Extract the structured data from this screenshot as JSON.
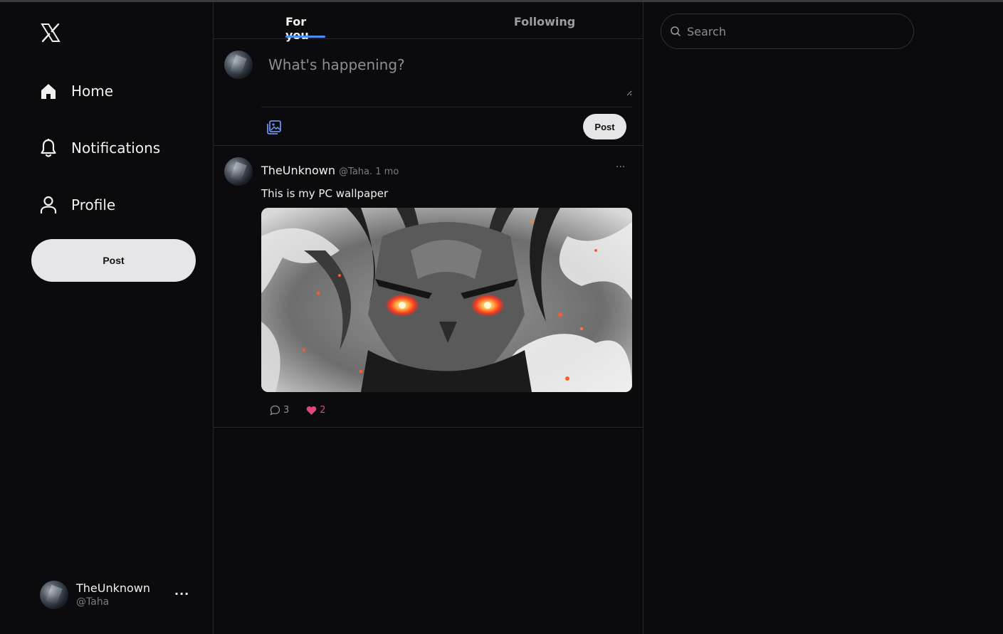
{
  "sidebar": {
    "logo_icon": "x-logo-icon",
    "nav": [
      {
        "label": "Home",
        "icon": "home-icon"
      },
      {
        "label": "Notifications",
        "icon": "bell-icon"
      },
      {
        "label": "Profile",
        "icon": "user-icon"
      }
    ],
    "post_label": "Post",
    "account": {
      "name": "TheUnknown",
      "handle": "@Taha",
      "more": "···"
    }
  },
  "main": {
    "tabs": [
      {
        "label": "For you",
        "active": true
      },
      {
        "label": "Following",
        "active": false
      }
    ],
    "composer": {
      "placeholder": "What's happening?",
      "media_icon": "image-gallery-icon",
      "post_label": "Post"
    },
    "feed": [
      {
        "name": "TheUnknown",
        "meta": "@Taha. 1 mo",
        "more": "···",
        "text": "This is my PC wallpaper",
        "reply_count": "3",
        "like_count": "2"
      }
    ]
  },
  "right": {
    "search_placeholder": "Search"
  },
  "colors": {
    "background": "#0b0b0d",
    "border": "#26272b",
    "accent_tab": "#4a8ef0",
    "like": "#e0457b",
    "button_bg": "#e6e6e8",
    "muted_text": "#7a7d82"
  }
}
